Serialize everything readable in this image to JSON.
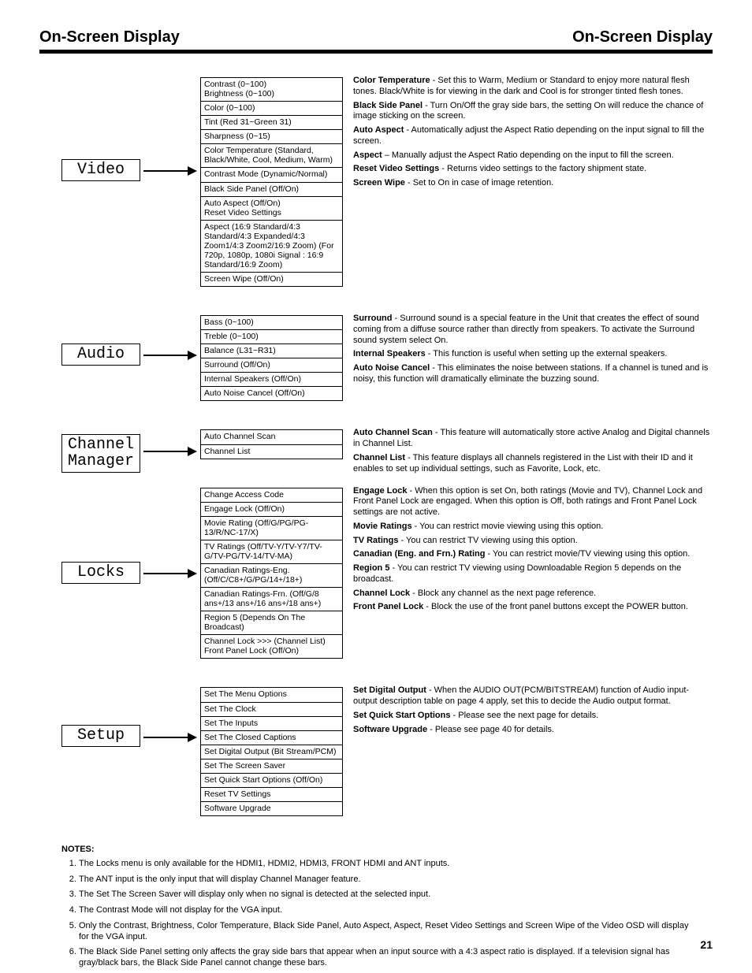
{
  "title_left": "On-Screen Display",
  "title_right": "On-Screen Display",
  "page_number": "21",
  "sections": [
    {
      "id": "video",
      "label": "Video",
      "rows": [
        "Contrast (0~100)\nBrightness (0~100)",
        "Color (0~100)",
        "Tint (Red 31~Green 31)",
        "Sharpness (0~15)",
        "Color Temperature (Standard, Black/White, Cool, Medium, Warm)",
        "Contrast Mode (Dynamic/Normal)",
        "Black Side Panel (Off/On)",
        "Auto Aspect (Off/On)\nReset Video Settings",
        "Aspect (16:9 Standard/4:3 Standard/4:3 Expanded/4:3 Zoom1/4:3 Zoom2/16:9 Zoom) (For 720p, 1080p, 1080i Signal : 16:9 Standard/16:9 Zoom)",
        "Screen Wipe (Off/On)"
      ],
      "desc": [
        [
          "Color Temperature",
          " - Set this to Warm, Medium or Standard to enjoy more natural flesh tones. Black/White is for viewing in the dark and Cool is for stronger tinted flesh tones."
        ],
        [
          "Black Side Panel",
          " - Turn On/Off the gray side bars, the setting On will reduce the chance of image sticking on the screen."
        ],
        [
          "Auto Aspect",
          " - Automatically adjust the Aspect Ratio depending on the input signal to fill the screen."
        ],
        [
          "Aspect",
          " – Manually adjust the Aspect Ratio depending on the input to fill the screen."
        ],
        [
          "Reset Video Settings",
          " - Returns video settings to the factory shipment state."
        ],
        [
          "Screen Wipe",
          " - Set to On in case of image retention."
        ]
      ]
    },
    {
      "id": "audio",
      "label": "Audio",
      "rows": [
        "Bass (0~100)",
        "Treble (0~100)",
        "Balance (L31~R31)",
        "Surround (Off/On)",
        "Internal Speakers (Off/On)",
        "Auto Noise Cancel (Off/On)"
      ],
      "desc": [
        [
          "Surround",
          " - Surround sound is a special feature in the Unit that creates the effect of sound coming from a diffuse source rather than directly from speakers. To activate the Surround sound system select On."
        ],
        [
          "Internal Speakers",
          " - This function is useful when setting up the external speakers."
        ],
        [
          "Auto Noise Cancel",
          " - This eliminates the noise between stations. If a channel is tuned and is noisy, this function will dramatically eliminate the buzzing sound."
        ]
      ]
    },
    {
      "id": "channel",
      "label": "Channel\nManager",
      "rows": [
        "Auto Channel Scan",
        "Channel List"
      ],
      "desc": [
        [
          "Auto Channel Scan",
          " - This feature will automatically store active Analog and Digital channels in Channel List."
        ],
        [
          "Channel List",
          " - This feature displays all channels registered in the List with their ID and it enables to set up individual settings, such as Favorite, Lock, etc."
        ]
      ]
    },
    {
      "id": "locks",
      "label": "Locks",
      "rows": [
        "Change Access Code",
        "Engage Lock (Off/On)",
        "Movie Rating (Off/G/PG/PG-13/R/NC-17/X)",
        "TV Ratings (Off/TV-Y/TV-Y7/TV-G/TV-PG/TV-14/TV-MA)",
        "Canadian Ratings-Eng. (Off/C/C8+/G/PG/14+/18+)",
        "Canadian Ratings-Frn. (Off/G/8 ans+/13 ans+/16 ans+/18 ans+)",
        "Region 5 (Depends On The Broadcast)",
        "Channel Lock >>> (Channel List)\nFront Panel Lock (Off/On)"
      ],
      "desc": [
        [
          "Engage Lock",
          " - When this option is set On, both ratings (Movie and TV), Channel Lock and Front Panel Lock are engaged. When this option is Off, both ratings and Front Panel Lock settings are not active."
        ],
        [
          "Movie Ratings",
          " - You can restrict movie viewing using this option."
        ],
        [
          "TV Ratings",
          " - You can restrict TV viewing using this option."
        ],
        [
          "Canadian (Eng. and Frn.) Rating",
          " - You can restrict movie/TV viewing using this option."
        ],
        [
          "Region 5",
          " - You can restrict TV viewing using Downloadable Region 5 depends on the broadcast."
        ],
        [
          "Channel Lock",
          " - Block any channel as the next page reference."
        ],
        [
          "Front Panel Lock",
          " - Block the use of the front panel buttons except the POWER button."
        ]
      ]
    },
    {
      "id": "setup",
      "label": "Setup",
      "rows": [
        "Set The Menu Options",
        "Set The Clock",
        "Set The Inputs",
        "Set The Closed Captions",
        "Set Digital Output (Bit Stream/PCM)",
        "Set The Screen Saver",
        "Set Quick Start Options (Off/On)",
        "Reset TV Settings",
        "Software Upgrade"
      ],
      "desc": [
        [
          "Set Digital Output",
          " - When the AUDIO OUT(PCM/BITSTREAM) function of Audio input-output description table on page 4 apply, set this to decide the Audio output format."
        ],
        [
          "Set Quick Start Options",
          " - Please see the next page for details."
        ],
        [
          "Software Upgrade",
          " - Please see page 40 for details."
        ]
      ]
    }
  ],
  "notes": {
    "head": "NOTES:",
    "items": [
      "The Locks menu is only available for the HDMI1, HDMI2, HDMI3, FRONT HDMI and ANT inputs.",
      "The ANT input is the only input that will display Channel Manager feature.",
      "The Set The Screen Saver will display only when no signal is detected at the selected input.",
      "The Contrast Mode will not display for the VGA input.",
      "Only the Contrast, Brightness, Color Temperature, Black Side Panel, Auto Aspect, Aspect, Reset Video Settings and Screen Wipe of the Video OSD will display for the VGA input.",
      "The Black Side Panel setting only affects the gray side bars that appear when an input source with a 4:3 aspect ratio is displayed. If a television signal has gray/black bars, the Black Side Panel cannot change these bars."
    ]
  }
}
